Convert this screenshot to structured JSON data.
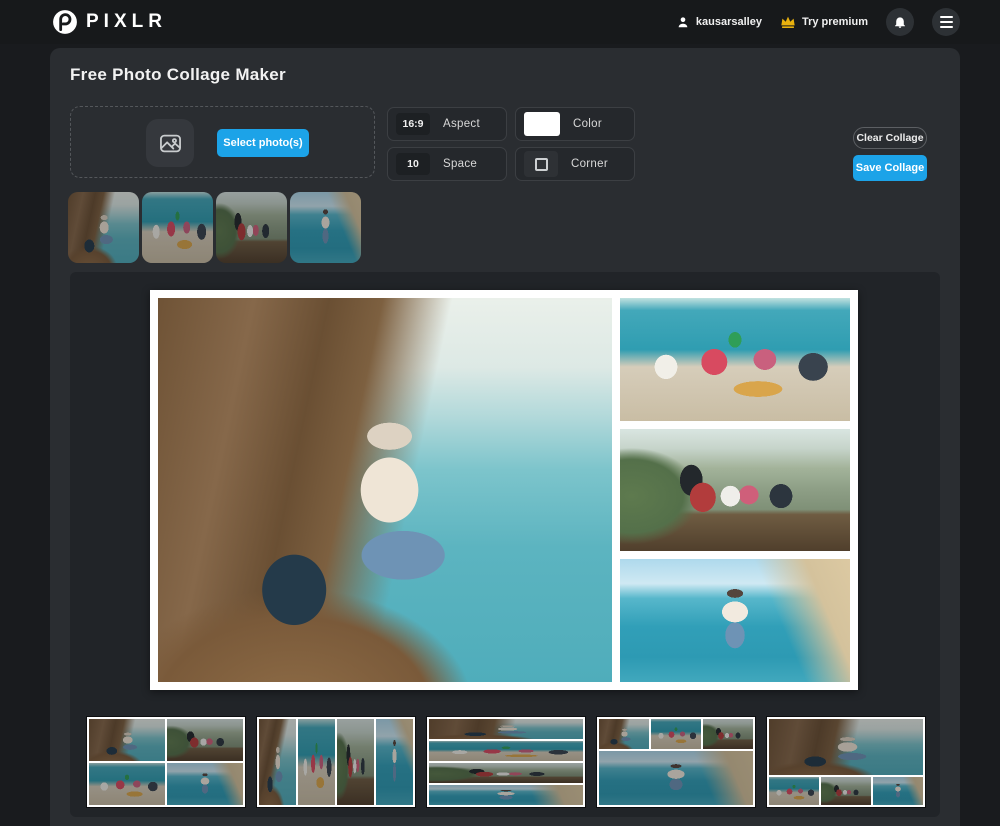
{
  "topbar": {
    "brand": "PIXLR",
    "user_name": "kausarsalley",
    "premium_label": "Try premium"
  },
  "page": {
    "title": "Free Photo Collage Maker"
  },
  "uploader": {
    "select_button": "Select photo(s)"
  },
  "controls": {
    "aspect": {
      "value": "16:9",
      "label": "Aspect"
    },
    "color": {
      "label": "Color",
      "value": "#ffffff"
    },
    "space": {
      "value": "10",
      "label": "Space"
    },
    "corner": {
      "label": "Corner"
    }
  },
  "actions": {
    "clear": "Clear Collage",
    "save": "Save Collage"
  },
  "photos": [
    {
      "id": "photo-1",
      "description": "woman in hat sitting on coastal cliff rocks with backpack"
    },
    {
      "id": "photo-2",
      "description": "friends toasting drinks at a cliffside picnic with pizza"
    },
    {
      "id": "photo-3",
      "description": "group of friends walking a boardwalk with guitar case"
    },
    {
      "id": "photo-4",
      "description": "woman standing on beach shoreline"
    }
  ],
  "collage_preview": {
    "layout": "large-left-with-right-column",
    "background": "#ffffff",
    "cells": [
      "photo-1",
      "photo-2",
      "photo-3",
      "photo-4"
    ]
  },
  "templates": [
    {
      "layout": "grid-2x2",
      "cells": [
        "photo-1",
        "photo-3",
        "photo-2",
        "photo-4"
      ]
    },
    {
      "layout": "four-vertical-strips",
      "cells": [
        "photo-1",
        "photo-2",
        "photo-3",
        "photo-4"
      ]
    },
    {
      "layout": "four-horizontal-strips",
      "cells": [
        "photo-1",
        "photo-2",
        "photo-3",
        "photo-4"
      ]
    },
    {
      "layout": "three-top-one-bottom",
      "cells": [
        "photo-1",
        "photo-2",
        "photo-3",
        "photo-4"
      ]
    },
    {
      "layout": "one-top-three-bottom",
      "cells": [
        "photo-2",
        "photo-3",
        "photo-4",
        "photo-1"
      ]
    }
  ],
  "colors": {
    "accent_blue": "#1ca3e8",
    "premium_gold": "#e9b10e",
    "page_bg": "#191b1e",
    "topbar_bg": "#17191b",
    "panel_bg": "#2a2d31",
    "workspace_bg": "#212428"
  }
}
